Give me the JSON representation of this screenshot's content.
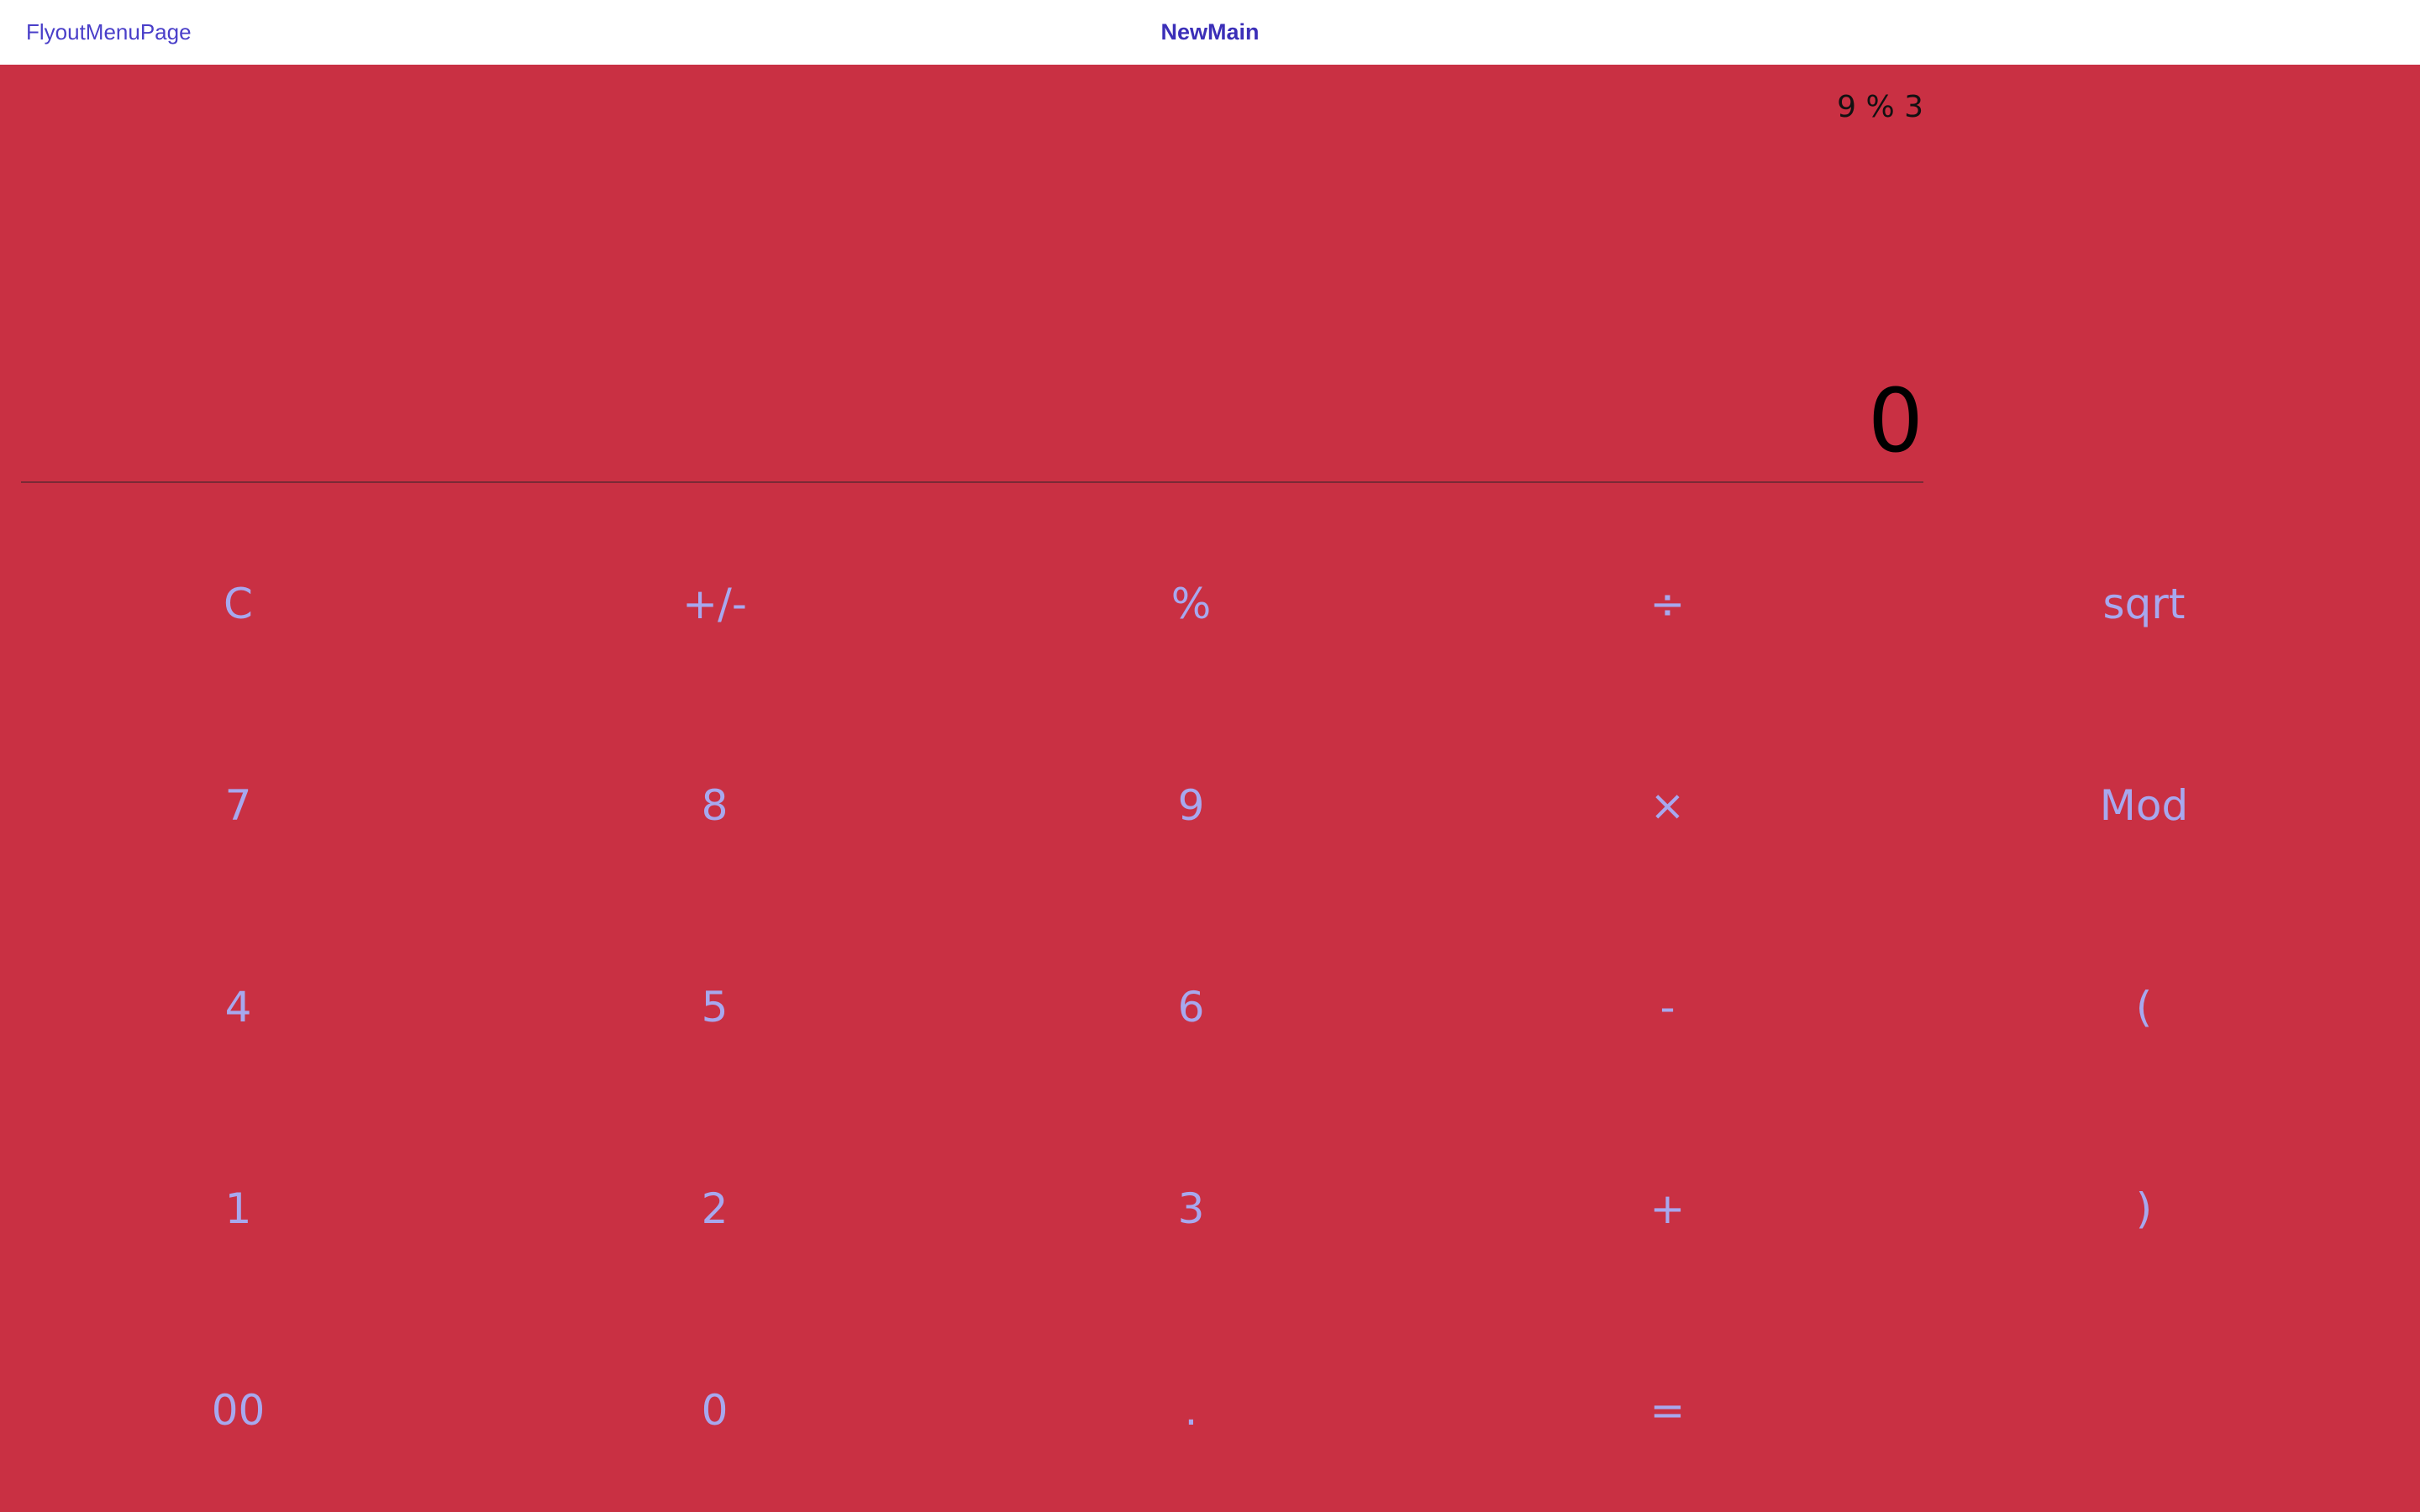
{
  "nav": {
    "back_label": "FlyoutMenuPage",
    "title": "NewMain"
  },
  "display": {
    "expression": "9 % 3",
    "result": "0"
  },
  "keypad": {
    "rows": [
      [
        {
          "label": "C",
          "name": "clear-button"
        },
        {
          "label": "+/-",
          "name": "negate-button"
        },
        {
          "label": "%",
          "name": "percent-button"
        },
        {
          "label": "÷",
          "name": "divide-button"
        },
        {
          "label": "sqrt",
          "name": "sqrt-button"
        }
      ],
      [
        {
          "label": "7",
          "name": "digit-7-button"
        },
        {
          "label": "8",
          "name": "digit-8-button"
        },
        {
          "label": "9",
          "name": "digit-9-button"
        },
        {
          "label": "×",
          "name": "multiply-button"
        },
        {
          "label": "Mod",
          "name": "mod-button"
        }
      ],
      [
        {
          "label": "4",
          "name": "digit-4-button"
        },
        {
          "label": "5",
          "name": "digit-5-button"
        },
        {
          "label": "6",
          "name": "digit-6-button"
        },
        {
          "label": "-",
          "name": "subtract-button"
        },
        {
          "label": "(",
          "name": "open-paren-button"
        }
      ],
      [
        {
          "label": "1",
          "name": "digit-1-button"
        },
        {
          "label": "2",
          "name": "digit-2-button"
        },
        {
          "label": "3",
          "name": "digit-3-button"
        },
        {
          "label": "+",
          "name": "add-button"
        },
        {
          "label": ")",
          "name": "close-paren-button"
        }
      ],
      [
        {
          "label": "00",
          "name": "double-zero-button"
        },
        {
          "label": "0",
          "name": "digit-0-button"
        },
        {
          "label": ".",
          "name": "decimal-button"
        },
        {
          "label": "=",
          "name": "equals-button"
        }
      ]
    ]
  },
  "colors": {
    "page_background": "#c93043",
    "key_text": "#a7a8ee",
    "nav_link": "#4a3fc9"
  }
}
